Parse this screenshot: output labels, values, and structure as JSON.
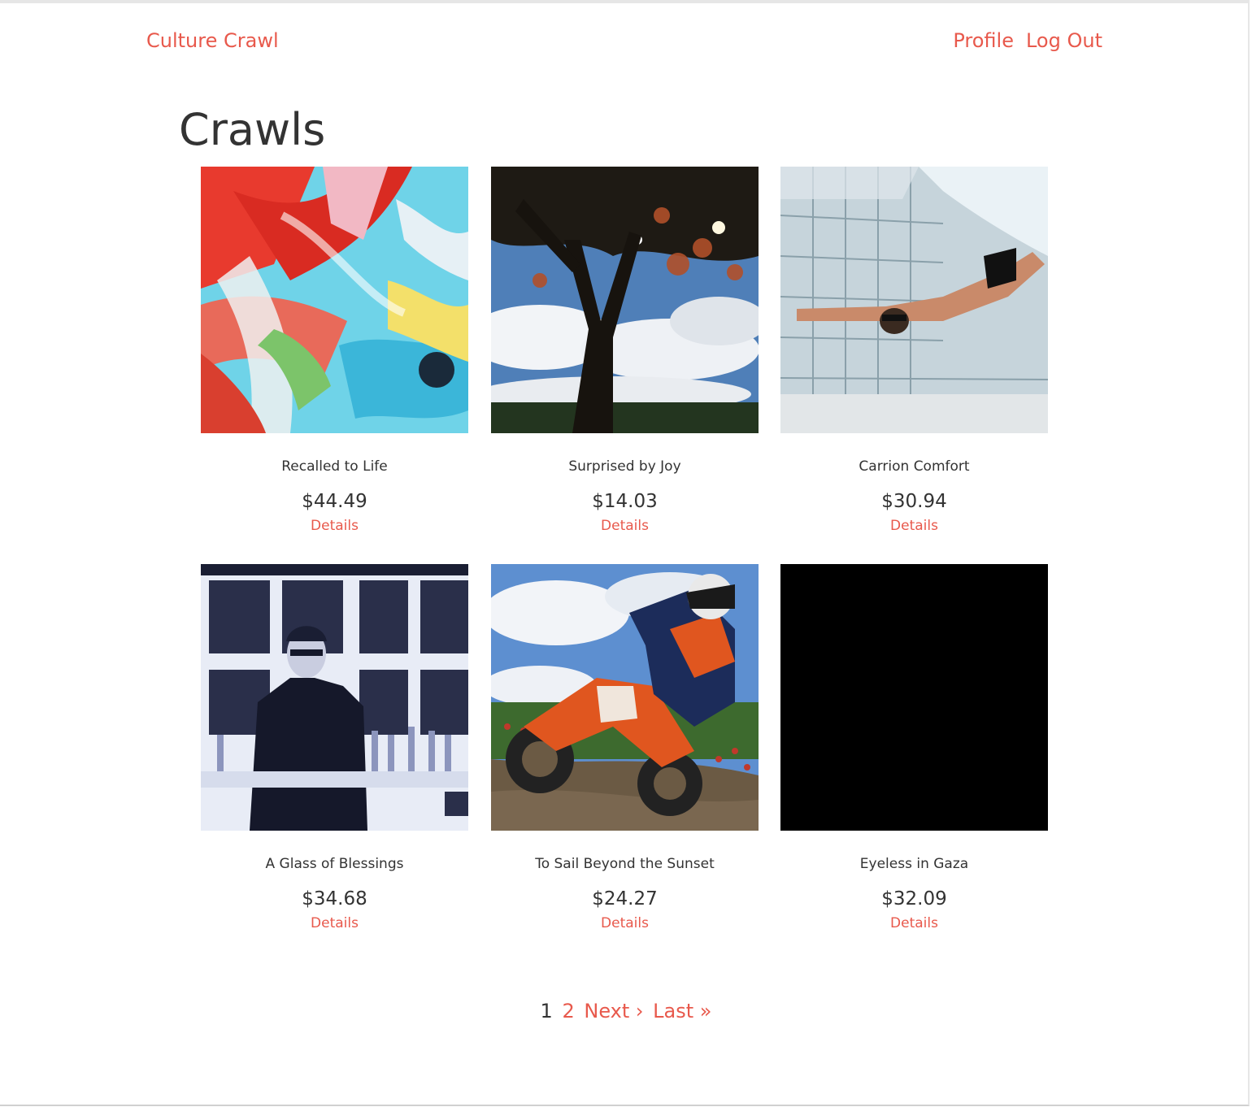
{
  "nav": {
    "brand": "Culture Crawl",
    "profile": "Profile",
    "logout": "Log Out"
  },
  "page": {
    "title": "Crawls"
  },
  "crawls": [
    {
      "title": "Recalled to Life",
      "price": "$44.49",
      "details": "Details",
      "image": "abstract-paint-image"
    },
    {
      "title": "Surprised by Joy",
      "price": "$14.03",
      "details": "Details",
      "image": "tree-sky-image"
    },
    {
      "title": "Carrion Comfort",
      "price": "$30.94",
      "details": "Details",
      "image": "underwater-swimmer-image"
    },
    {
      "title": "A Glass of Blessings",
      "price": "$34.68",
      "details": "Details",
      "image": "bartender-image"
    },
    {
      "title": "To Sail Beyond the Sunset",
      "price": "$24.27",
      "details": "Details",
      "image": "motocross-image"
    },
    {
      "title": "Eyeless in Gaza",
      "price": "$32.09",
      "details": "Details",
      "image": "black-image"
    }
  ],
  "pagination": {
    "current": "1",
    "page2": "2",
    "next": "Next ›",
    "last": "Last »"
  },
  "colors": {
    "link": "#e8594c",
    "text": "#333333"
  }
}
